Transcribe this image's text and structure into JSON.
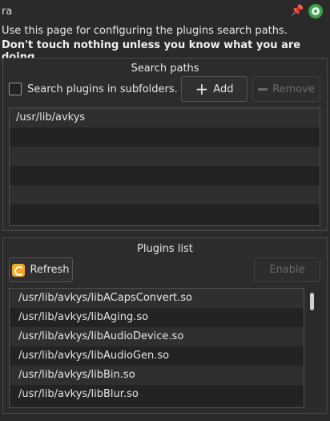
{
  "window": {
    "title": "ra",
    "pin_icon": "pin-icon",
    "app_icon": "app-badge-icon",
    "accent": "#3aa34a"
  },
  "info": {
    "line1": "Use this page for configuring the plugins search paths.",
    "line2": "Don't touch nothing unless you know what you are doing."
  },
  "search_paths": {
    "title": "Search paths",
    "subfolders_label": "Search plugins in subfolders.",
    "subfolders_checked": false,
    "add_label": "Add",
    "remove_label": "Remove",
    "paths": [
      "/usr/lib/avkys",
      "",
      "",
      "",
      "",
      ""
    ]
  },
  "plugins": {
    "title": "Plugins list",
    "refresh_label": "Refresh",
    "enable_label": "Enable",
    "items": [
      "/usr/lib/avkys/libACapsConvert.so",
      "/usr/lib/avkys/libAging.so",
      "/usr/lib/avkys/libAudioDevice.so",
      "/usr/lib/avkys/libAudioGen.so",
      "/usr/lib/avkys/libBin.so",
      "/usr/lib/avkys/libBlur.so"
    ],
    "refresh_icon_color": "#f5a623"
  }
}
